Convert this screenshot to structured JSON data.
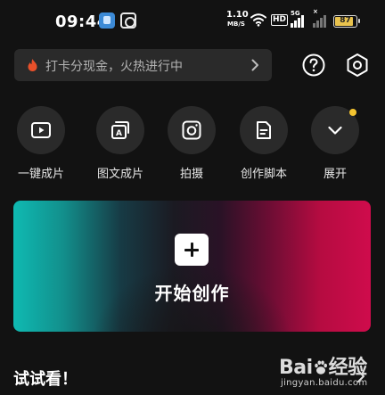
{
  "status_bar": {
    "time": "09:44",
    "net_speed_value": "1.10",
    "net_speed_unit": "MB/S",
    "hd_badge": "HD",
    "signal_tag_1": "5G",
    "signal_tag_2": "×",
    "battery_level": "87",
    "battery_fraction": 0.87,
    "app_icons": [
      "notification-app-icon",
      "notification-app-icon-2"
    ]
  },
  "promo": {
    "text": "打卡分现金，火热进行中",
    "fire_color": "#e8502a"
  },
  "header_actions": {
    "help_icon": "help-circle-icon",
    "settings_icon": "hexagon-settings-icon"
  },
  "tools": [
    {
      "label": "一键成片",
      "icon": "play-video-icon"
    },
    {
      "label": "图文成片",
      "icon": "image-text-icon"
    },
    {
      "label": "拍摄",
      "icon": "camera-icon"
    },
    {
      "label": "创作脚本",
      "icon": "script-document-icon"
    },
    {
      "label": "展开",
      "icon": "chevron-down-icon",
      "badge_color": "#f4c430"
    }
  ],
  "create": {
    "label": "开始创作",
    "gradient_colors": [
      "#0fbab2",
      "#1b1a22",
      "#cf0c4c"
    ]
  },
  "section": {
    "title": "试试看！"
  },
  "watermark": {
    "logo_text_1": "Bai",
    "logo_text_2": "经验",
    "site": "jingyan.baidu.com"
  }
}
